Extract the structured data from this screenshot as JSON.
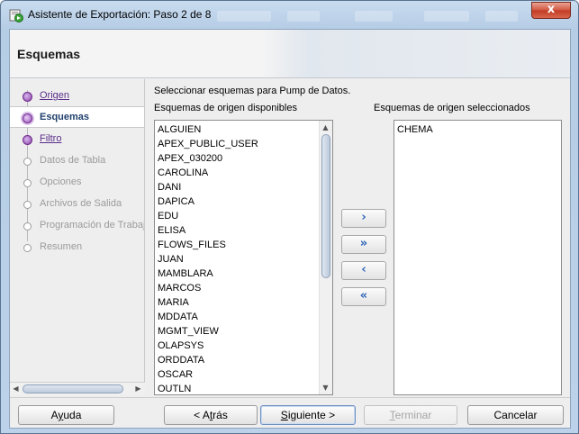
{
  "window": {
    "title": "Asistente de Exportación: Paso 2 de 8",
    "close_glyph": "x",
    "icon": "export-wizard-icon"
  },
  "header": {
    "title": "Esquemas"
  },
  "steps": [
    {
      "label": "Origen",
      "state": "done"
    },
    {
      "label": "Esquemas",
      "state": "current"
    },
    {
      "label": "Filtro",
      "state": "done"
    },
    {
      "label": "Datos de Tabla",
      "state": "todo"
    },
    {
      "label": "Opciones",
      "state": "todo"
    },
    {
      "label": "Archivos de Salida",
      "state": "todo"
    },
    {
      "label": "Programación de Trabajo",
      "state": "todo"
    },
    {
      "label": "Resumen",
      "state": "todo"
    }
  ],
  "content": {
    "instruction": "Seleccionar esquemas para Pump de Datos.",
    "available_label": "Esquemas de origen disponibles",
    "selected_label": "Esquemas de origen seleccionados",
    "available": [
      "ALGUIEN",
      "APEX_PUBLIC_USER",
      "APEX_030200",
      "CAROLINA",
      "DANI",
      "DAPICA",
      "EDU",
      "ELISA",
      "FLOWS_FILES",
      "JUAN",
      "MAMBLARA",
      "MARCOS",
      "MARIA",
      "MDDATA",
      "MGMT_VIEW",
      "OLAPSYS",
      "ORDDATA",
      "OSCAR",
      "OUTLN"
    ],
    "selected": [
      "CHEMA"
    ]
  },
  "move_buttons": {
    "add": "›",
    "add_all": "»",
    "remove": "‹",
    "remove_all": "«"
  },
  "footer": {
    "help": "Ayuda",
    "back": "< Atrás",
    "next": "Siguiente >",
    "finish": "Terminar",
    "cancel": "Cancelar"
  }
}
